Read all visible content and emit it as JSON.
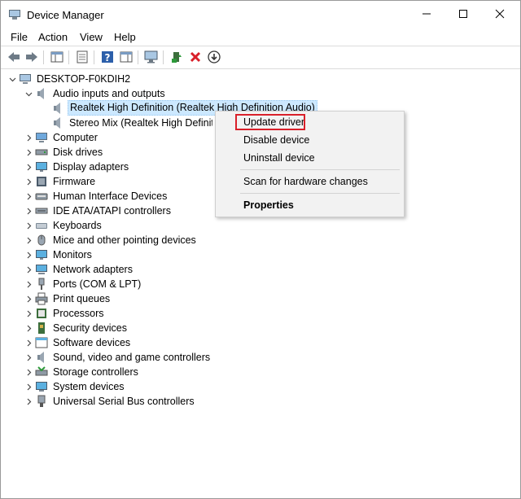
{
  "window": {
    "title": "Device Manager"
  },
  "menu": [
    "File",
    "Action",
    "View",
    "Help"
  ],
  "tree": {
    "root": "DESKTOP-F0KDIH2",
    "expanded_category": "Audio inputs and outputs",
    "children": [
      "Realtek High Definition (Realtek High Definition Audio)",
      "Stereo Mix (Realtek High Definition Audio)"
    ],
    "categories": [
      "Computer",
      "Disk drives",
      "Display adapters",
      "Firmware",
      "Human Interface Devices",
      "IDE ATA/ATAPI controllers",
      "Keyboards",
      "Mice and other pointing devices",
      "Monitors",
      "Network adapters",
      "Ports (COM & LPT)",
      "Print queues",
      "Processors",
      "Security devices",
      "Software devices",
      "Sound, video and game controllers",
      "Storage controllers",
      "System devices",
      "Universal Serial Bus controllers"
    ]
  },
  "context_menu": {
    "update_driver": "Update driver",
    "disable_device": "Disable device",
    "uninstall_device": "Uninstall device",
    "scan": "Scan for hardware changes",
    "properties": "Properties"
  },
  "colors": {
    "selection": "#cce8ff",
    "highlight_box": "#d9202a",
    "menu_bg": "#f2f2f2"
  }
}
